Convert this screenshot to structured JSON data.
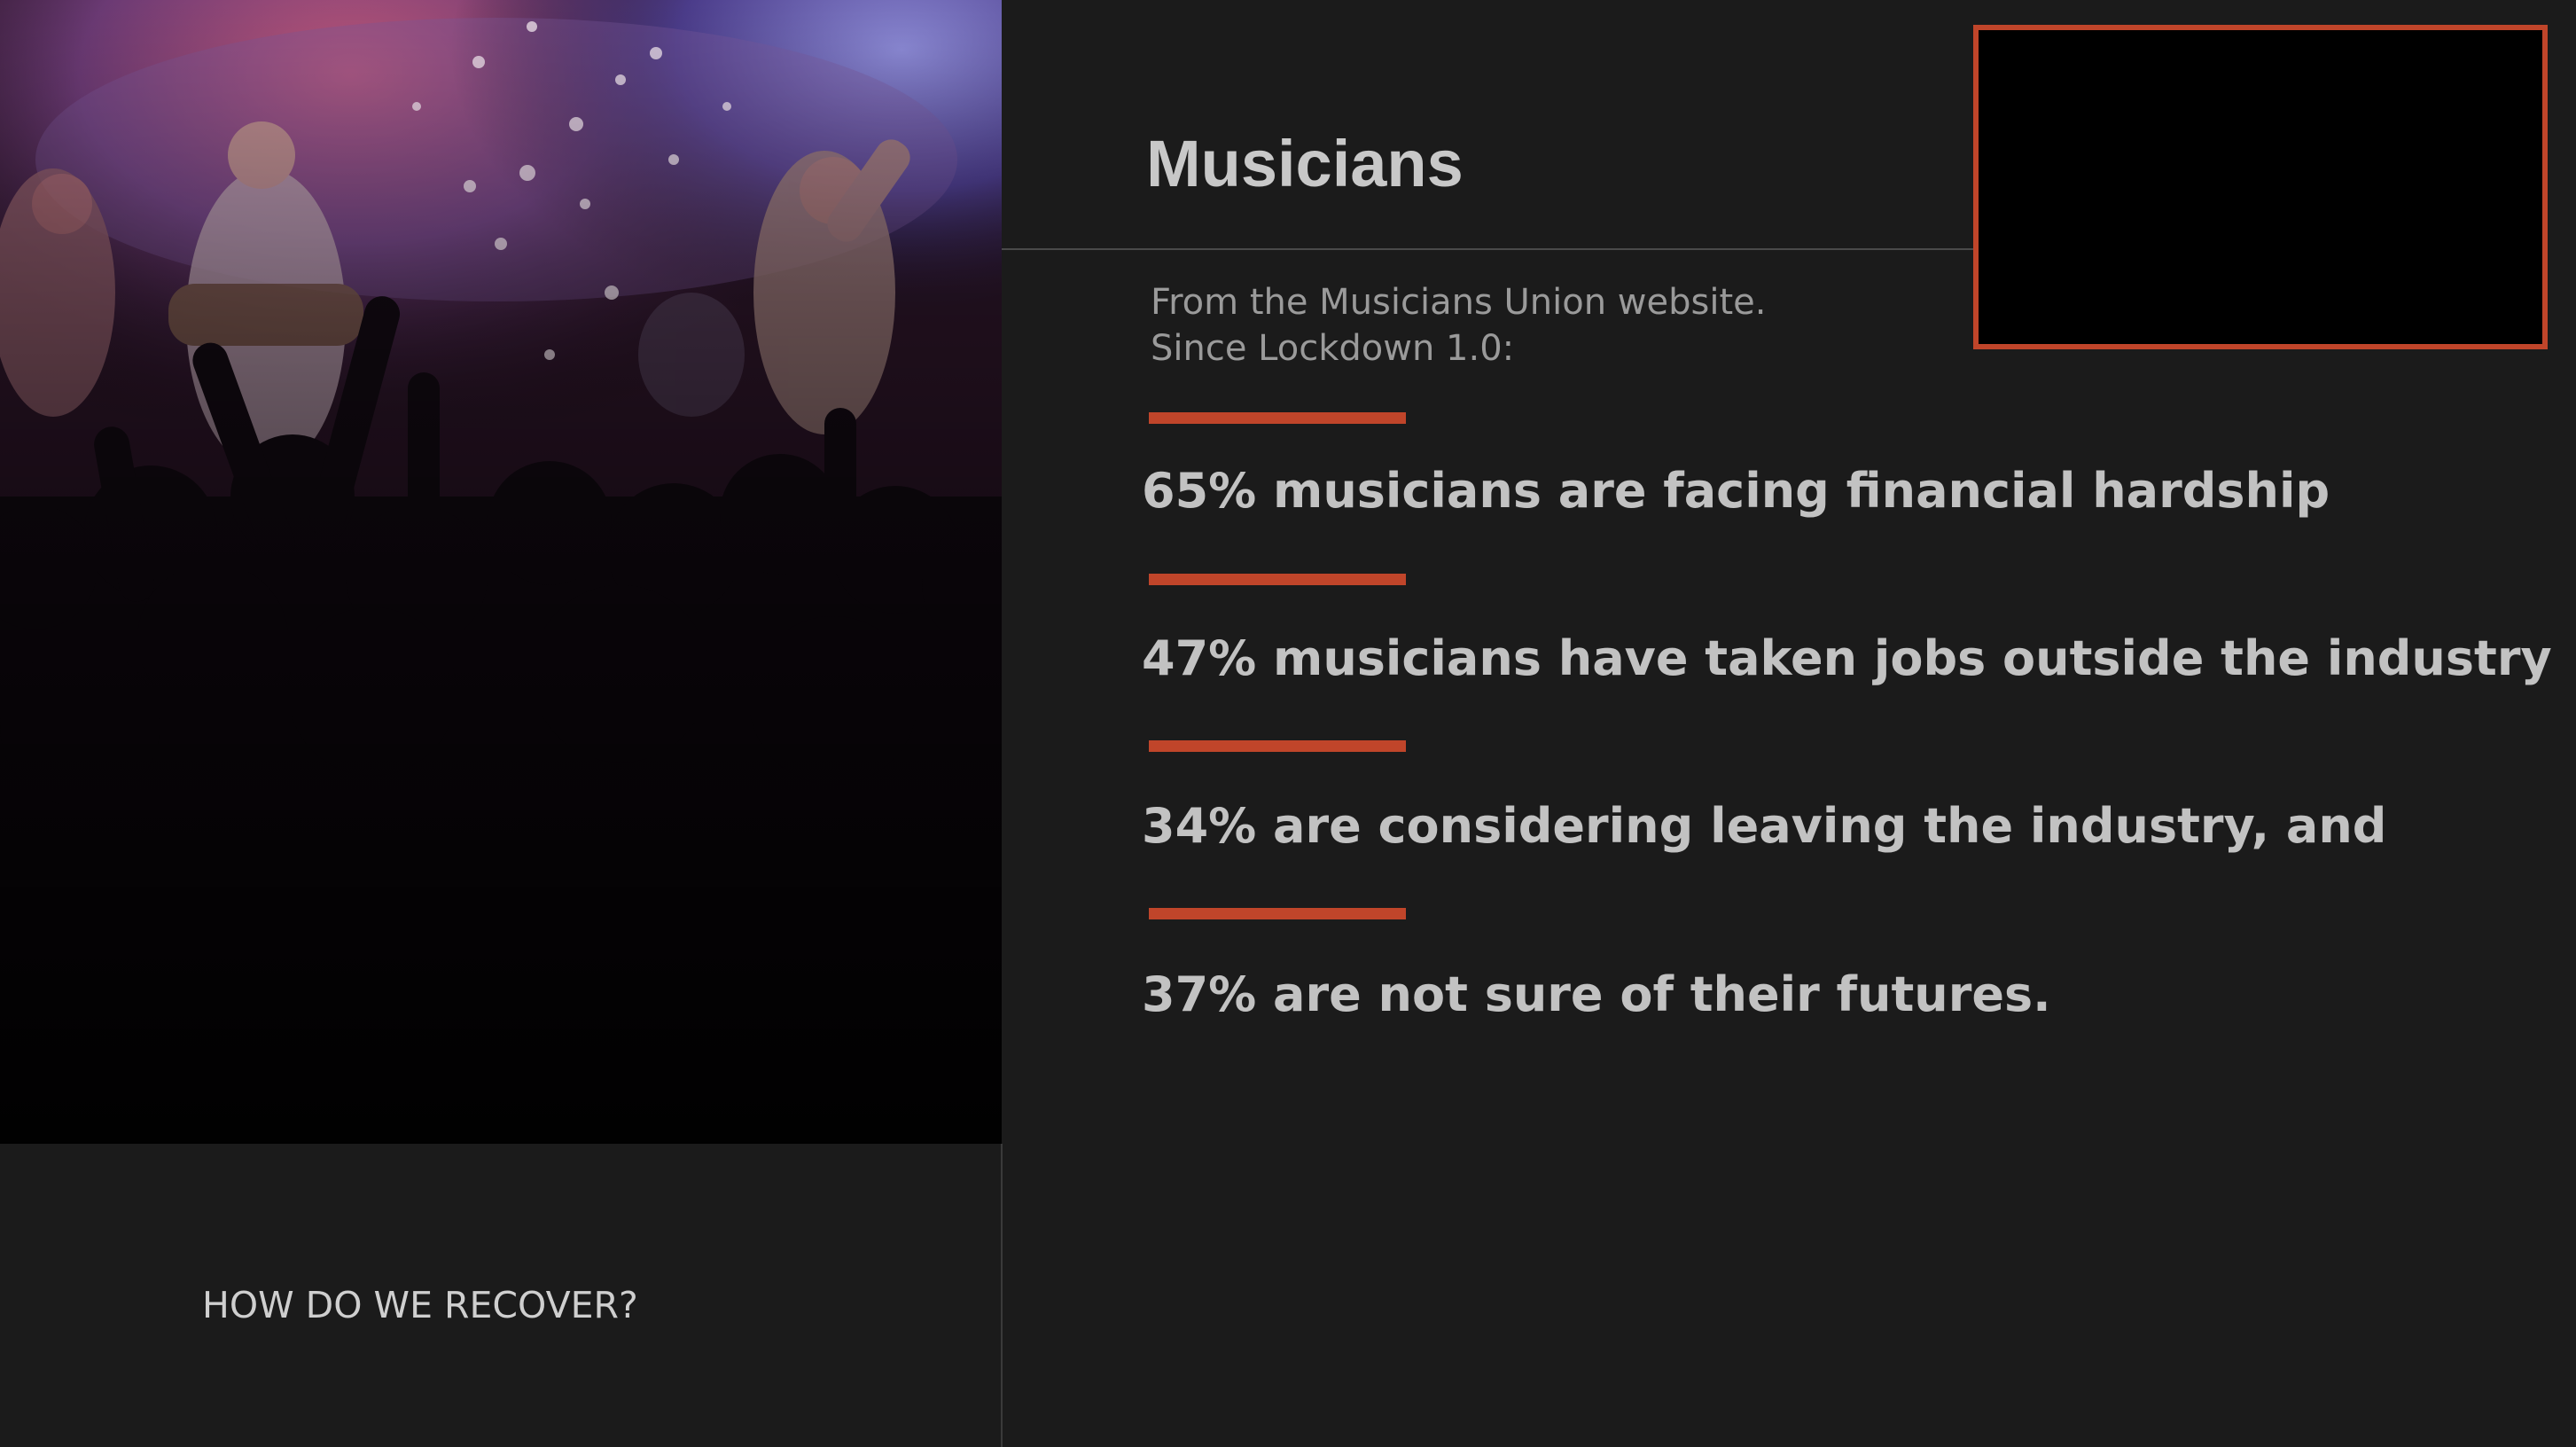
{
  "slide": {
    "title": "Musicians",
    "subtitle_lines": [
      "From the Musicians Union website.",
      "Since Lockdown 1.0:"
    ],
    "stats": [
      "65% musicians are facing financial hardship",
      "47% musicians have taken jobs outside the industry",
      "34% are considering leaving the industry, and",
      "37% are not sure of their futures."
    ],
    "footer": "HOW DO WE RECOVER?"
  },
  "colors": {
    "background": "#1b1b1b",
    "accent": "#c0452a",
    "title_text": "#c8c8c8",
    "subtitle_text": "#9a9a9a",
    "stat_text": "#c2c2c2"
  },
  "images": {
    "photo_semantic": "concert-crowd-photo",
    "video_semantic": "embedded-video-placeholder"
  }
}
